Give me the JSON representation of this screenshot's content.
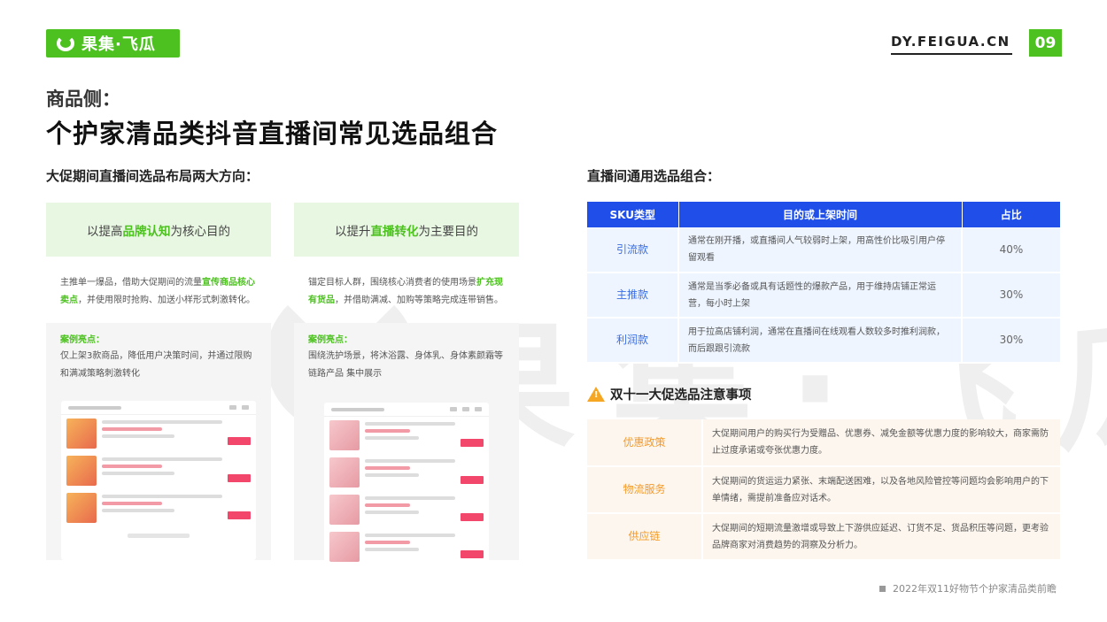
{
  "header": {
    "logo_text": "果集·飞瓜",
    "site_url": "DY.FEIGUA.CN",
    "page_number": "09"
  },
  "subtitle": "商品侧：",
  "title": "个护家清品类抖音直播间常见选品组合",
  "left": {
    "heading": "大促期间直播间选品布局两大方向：",
    "columns": [
      {
        "head_pre": "以提高",
        "head_hl": "品牌认知",
        "head_post": "为核心目的",
        "desc_pre": "主推单一爆品，借助大促期间的流量",
        "desc_hl": "宣传商品核心卖点",
        "desc_post": "，并使用限时抢购、加送小样形式刺激转化。",
        "case_title": "案例亮点：",
        "case_text": "仅上架3款商品，降低用户决策时间，并通过限购和满减策略刺激转化"
      },
      {
        "head_pre": "以提升",
        "head_hl": "直播转化",
        "head_post": "为主要目的",
        "desc_pre": "锚定目标人群，围绕核心消费者的使用场景",
        "desc_hl": "扩充现有货品",
        "desc_post": "，并借助满减、加购等策略完成连带销售。",
        "case_title": "案例亮点：",
        "case_text": "围绕洗护场景，将沐浴露、身体乳、身体素颜霜等链路产品 集中展示"
      }
    ]
  },
  "right": {
    "heading": "直播间通用选品组合：",
    "table_headers": [
      "SKU类型",
      "目的或上架时间",
      "占比"
    ],
    "rows": [
      {
        "type": "引流款",
        "desc": "通常在刚开播，或直播间人气较弱时上架，用高性价比吸引用户停留观看",
        "pct": "40%"
      },
      {
        "type": "主推款",
        "desc": "通常是当季必备或具有话题性的爆款产品，用于维持店铺正常运营，每小时上架",
        "pct": "30%"
      },
      {
        "type": "利润款",
        "desc": "用于拉高店铺利润，通常在直播间在线观看人数较多时推利润款，而后跟跟引流款",
        "pct": "30%"
      }
    ],
    "notice_title": "双十一大促选品注意事项",
    "notice_icon_glyph": "!",
    "notices": [
      {
        "type": "优惠政策",
        "desc": "大促期间用户的购买行为受赠品、优惠券、减免金额等优惠力度的影响较大，商家需防止过度承诺或夸张优惠力度。"
      },
      {
        "type": "物流服务",
        "desc": "大促期间的货运运力紧张、末端配送困难，以及各地风险管控等问题均会影响用户的下单情绪，需提前准备应对话术。"
      },
      {
        "type": "供应链",
        "desc": "大促期间的短期流量激增或导致上下游供应延迟、订货不足、货品积压等问题，更考验品牌商家对消费趋势的洞察及分析力。"
      }
    ]
  },
  "footer": "2022年双11好物节个护家清品类前瞻",
  "colors": {
    "brand_green": "#4cc11f",
    "table_blue": "#1f4fe8",
    "notice_orange": "#f39a2b"
  }
}
